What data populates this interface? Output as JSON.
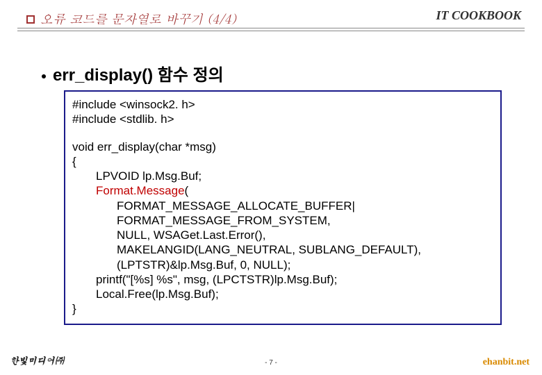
{
  "header": {
    "title": "오류 코드를 문자열로 바꾸기 (4/4)",
    "brand": "IT COOKBOOK"
  },
  "section": {
    "heading": "err_display() 함수 정의"
  },
  "code": {
    "line1": "#include <winsock2. h>",
    "line2": "#include <stdlib. h>",
    "line3": "void err_display(char *msg)",
    "line4": "{",
    "line5": "LPVOID lp.Msg.Buf;",
    "line6_kw": "Format.Message",
    "line6_rest": "(",
    "line7": "FORMAT_MESSAGE_ALLOCATE_BUFFER|",
    "line8": "FORMAT_MESSAGE_FROM_SYSTEM,",
    "line9": "NULL, WSAGet.Last.Error(),",
    "line10": "MAKELANGID(LANG_NEUTRAL, SUBLANG_DEFAULT),",
    "line11": "(LPTSTR)&lp.Msg.Buf, 0, NULL);",
    "line12": "printf(\"[%s] %s\", msg, (LPCTSTR)lp.Msg.Buf);",
    "line13": "Local.Free(lp.Msg.Buf);",
    "line14": "}"
  },
  "footer": {
    "left": "한빛미디어㈜",
    "page": "- 7 -",
    "right": "ehanbit.net"
  }
}
